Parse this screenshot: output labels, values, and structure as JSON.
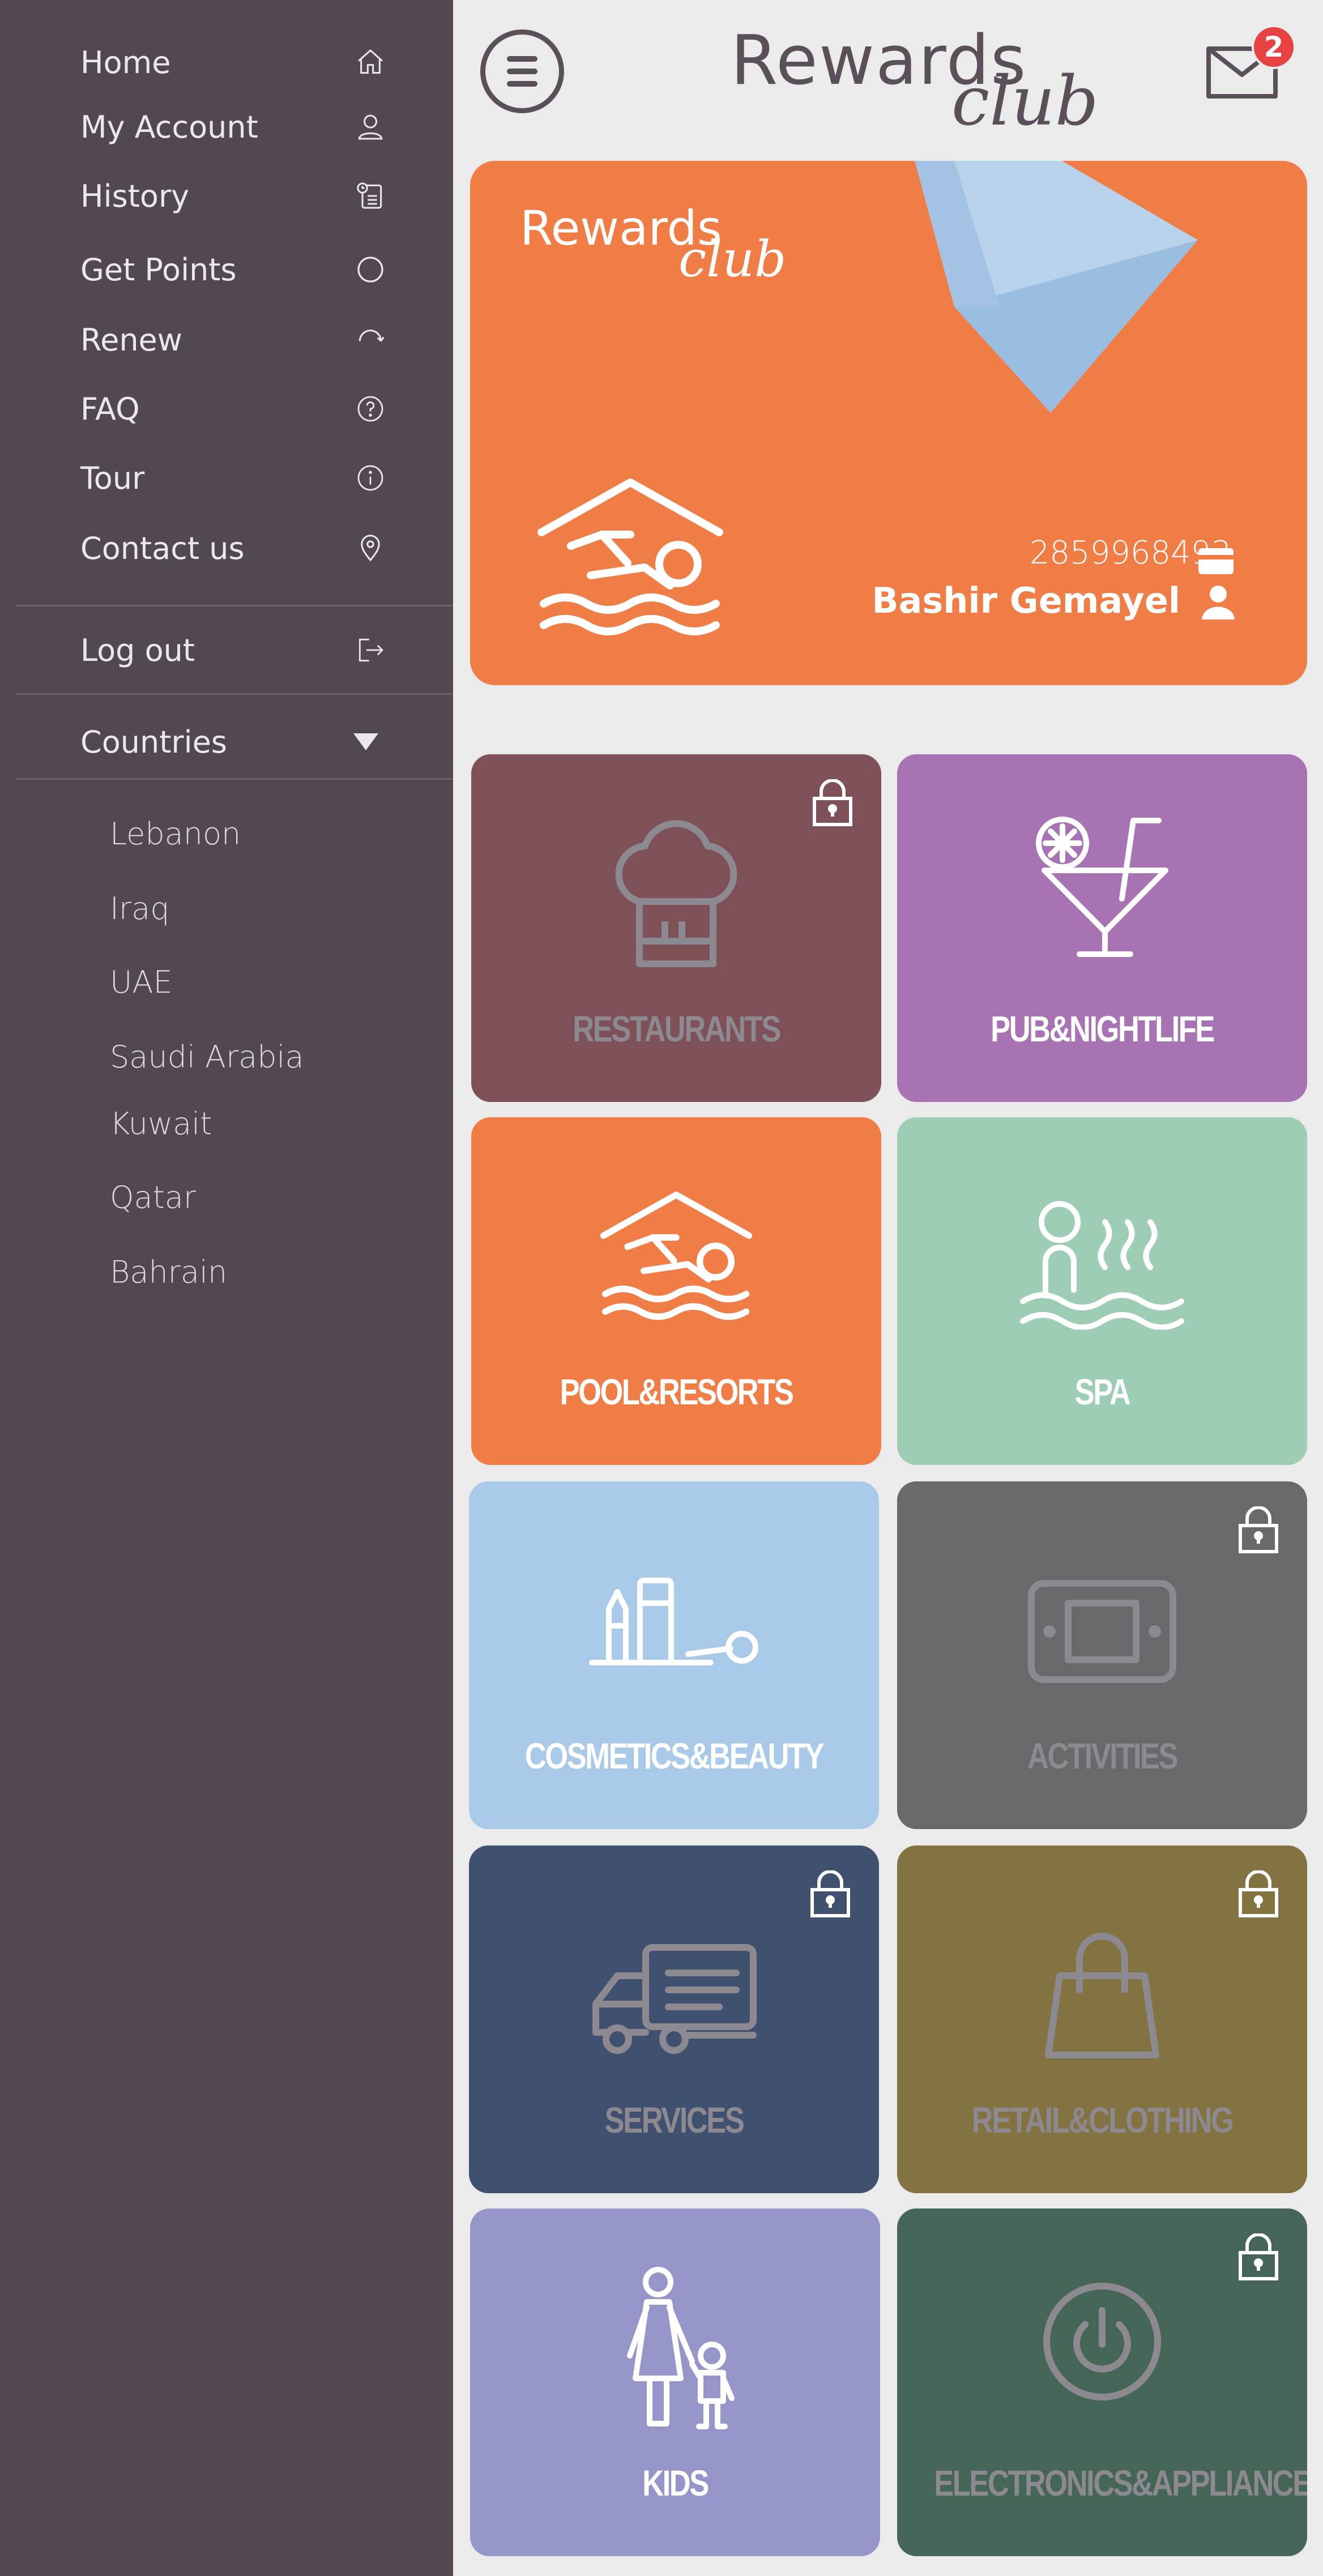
{
  "sidebar": {
    "menu": [
      {
        "label": "Home",
        "icon": "home-icon"
      },
      {
        "label": "My Account",
        "icon": "user-icon"
      },
      {
        "label": "History",
        "icon": "history-icon"
      },
      {
        "label": "Get Points",
        "icon": "circle-icon"
      },
      {
        "label": "Renew",
        "icon": "refresh-icon"
      },
      {
        "label": "FAQ",
        "icon": "question-icon"
      },
      {
        "label": "Tour",
        "icon": "info-icon"
      },
      {
        "label": "Contact us",
        "icon": "location-pin-icon"
      }
    ],
    "logout": {
      "label": "Log out",
      "icon": "logout-icon"
    },
    "countries": {
      "label": "Countries",
      "items": [
        "Lebanon",
        "Iraq",
        "UAE",
        "Saudi Arabia",
        "Kuwait",
        "Qatar",
        "Bahrain"
      ]
    }
  },
  "header": {
    "brand_word": "Rewards",
    "brand_script": "club",
    "notifications": 2
  },
  "card": {
    "brand_word": "Rewards",
    "brand_script": "club",
    "number": "2859968493",
    "holder": "Bashir Gemayel",
    "color": "#ef7d45"
  },
  "categories": [
    {
      "label": "RESTAURANTS",
      "icon": "chef-hat-icon",
      "locked": true,
      "color": "#7e5058"
    },
    {
      "label": "PUB&NIGHTLIFE",
      "icon": "cocktail-icon",
      "locked": false,
      "color": "#a873b2"
    },
    {
      "label": "POOL&RESORTS",
      "icon": "swimmer-icon",
      "locked": false,
      "color": "#ef7d45"
    },
    {
      "label": "SPA",
      "icon": "spa-icon",
      "locked": false,
      "color": "#9dcdb4"
    },
    {
      "label": "COSMETICS&BEAUTY",
      "icon": "cosmetics-icon",
      "locked": false,
      "color": "#a9c9e8"
    },
    {
      "label": "ACTIVITIES",
      "icon": "game-console-icon",
      "locked": true,
      "color": "#6b686c"
    },
    {
      "label": "SERVICES",
      "icon": "truck-icon",
      "locked": true,
      "color": "#3f516e"
    },
    {
      "label": "RETAIL&CLOTHING",
      "icon": "shopping-bag-icon",
      "locked": true,
      "color": "#827340"
    },
    {
      "label": "KIDS",
      "icon": "parent-child-icon",
      "locked": false,
      "color": "#9595ca"
    },
    {
      "label": "ELECTRONICS&APPLIANCES",
      "icon": "power-icon",
      "locked": true,
      "color": "#456656"
    }
  ]
}
